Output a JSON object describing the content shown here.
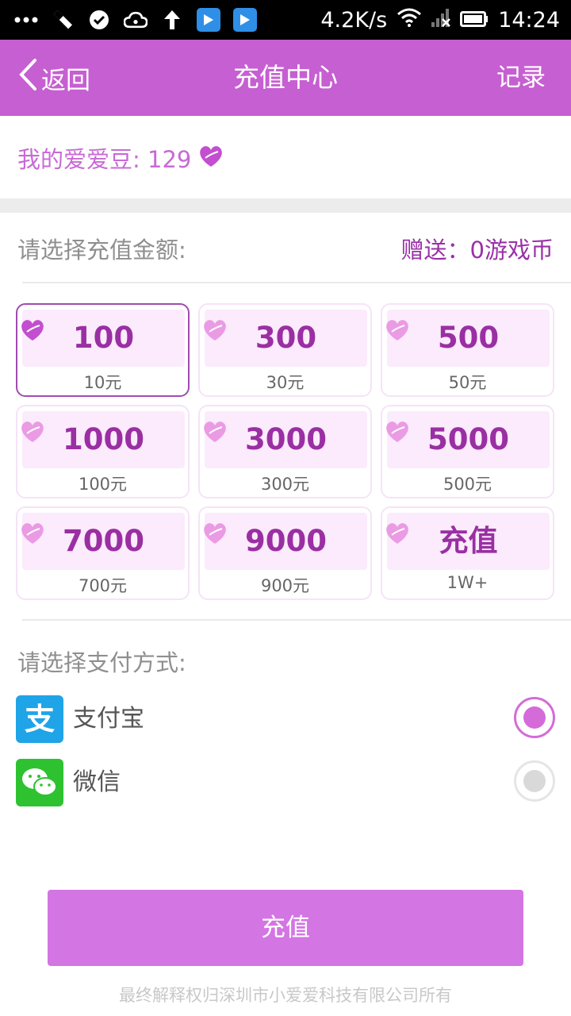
{
  "status_bar": {
    "speed": "4.2K/s",
    "time": "14:24",
    "icons": [
      "more-dots-icon",
      "tool-icon",
      "check-circle-icon",
      "cloud-icon",
      "upload-arrow-icon",
      "play-app-icon",
      "play-app-icon",
      "wifi-icon",
      "signal-icon",
      "battery-icon"
    ]
  },
  "header": {
    "back_label": "返回",
    "title": "充值中心",
    "records_label": "记录"
  },
  "balance": {
    "label": "我的爱爱豆: 129"
  },
  "amount_section": {
    "label": "请选择充值金额:",
    "bonus": "赠送：0游戏币"
  },
  "packages": [
    {
      "amount": "100",
      "price": "10元",
      "selected": true
    },
    {
      "amount": "300",
      "price": "30元",
      "selected": false
    },
    {
      "amount": "500",
      "price": "50元",
      "selected": false
    },
    {
      "amount": "1000",
      "price": "100元",
      "selected": false
    },
    {
      "amount": "3000",
      "price": "300元",
      "selected": false
    },
    {
      "amount": "5000",
      "price": "500元",
      "selected": false
    },
    {
      "amount": "7000",
      "price": "700元",
      "selected": false
    },
    {
      "amount": "9000",
      "price": "900元",
      "selected": false
    },
    {
      "amount": "充值",
      "price": "1W+",
      "selected": false
    }
  ],
  "payment_section": {
    "label": "请选择支付方式:",
    "methods": [
      {
        "name": "支付宝",
        "icon": "alipay-icon",
        "selected": true
      },
      {
        "name": "微信",
        "icon": "wechat-icon",
        "selected": false
      }
    ]
  },
  "submit_label": "充值",
  "footer": "最终解释权归深圳市小爱爱科技有限公司所有",
  "colors": {
    "header": "#c65fd1",
    "accent_text": "#9a2fa3",
    "button": "#d375e3",
    "card_fill": "#fcebfc"
  }
}
